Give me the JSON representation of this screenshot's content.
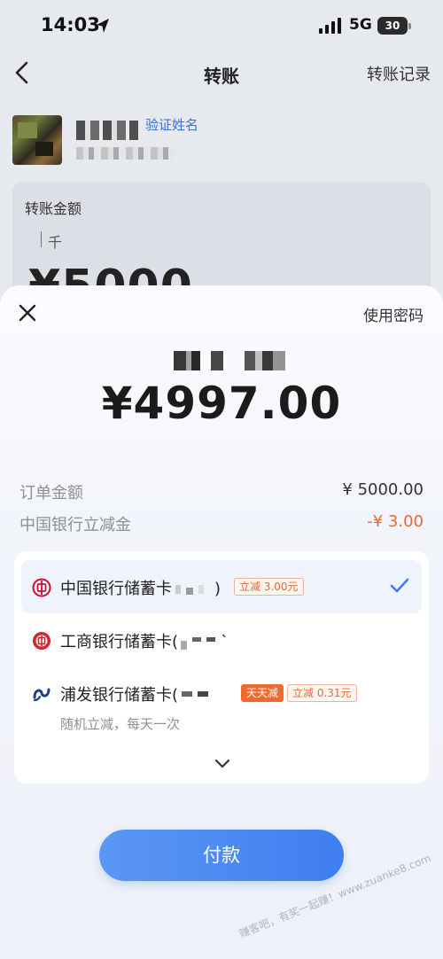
{
  "status_bar": {
    "time": "14:03",
    "network": "5G",
    "battery": "30",
    "icons": [
      "location-arrow-icon",
      "signal-icon",
      "battery-icon"
    ]
  },
  "background_page": {
    "title": "转账",
    "records_link": "转账记录",
    "verify_name": "验证姓名",
    "amount_label": "转账金额",
    "amount_unit": "千",
    "amount_value": "¥5000"
  },
  "sheet": {
    "use_password": "使用密码",
    "pay_amount": "¥4997.00",
    "details": [
      {
        "label": "订单金额",
        "value": "¥ 5000.00",
        "kind": "normal"
      },
      {
        "label": "中国银行立减金",
        "value": "-¥ 3.00",
        "kind": "discount"
      }
    ],
    "cards": [
      {
        "name": "中国银行储蓄卡",
        "suffix": ")",
        "badges": [
          {
            "text": "立减 3.00元",
            "style": "outline"
          }
        ],
        "selected": true,
        "icon": "boc-bank-icon"
      },
      {
        "name": "工商银行储蓄卡(",
        "suffix": "`",
        "badges": [],
        "selected": false,
        "icon": "icbc-bank-icon"
      },
      {
        "name": "浦发银行储蓄卡(",
        "suffix": "",
        "badges": [
          {
            "text": "天天减",
            "style": "solid"
          },
          {
            "text": "立减 0.31元",
            "style": "outline"
          }
        ],
        "selected": false,
        "icon": "spdb-bank-icon",
        "sub": "随机立减，每天一次"
      }
    ],
    "pay_button": "付款"
  },
  "watermark": "赚客吧，有奖一起赚！www.zuanke8.com",
  "colors": {
    "accent_blue": "#3f7ef0",
    "discount_orange": "#e3683a",
    "badge_orange": "#f06a2f",
    "boc_red": "#c8102e",
    "icbc_red": "#d3252a",
    "spdb_blue": "#1d3c8a"
  }
}
